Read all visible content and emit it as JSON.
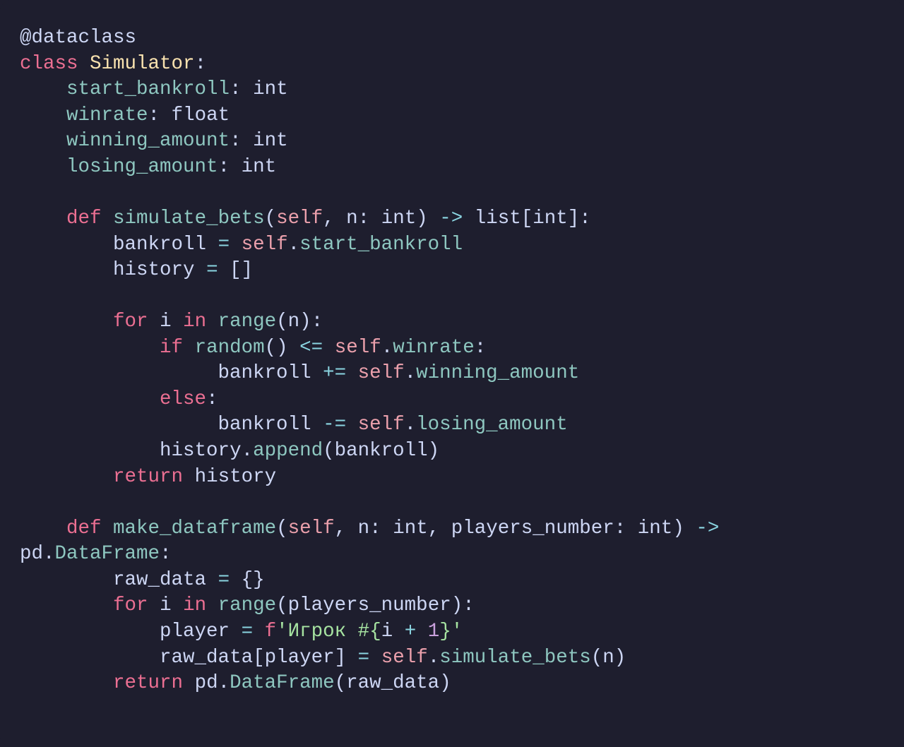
{
  "code": {
    "decorator_at": "@",
    "decorator_name": "dataclass",
    "kw_class": "class",
    "class_name": "Simulator",
    "colon": ":",
    "fields": {
      "start_bankroll": "start_bankroll",
      "winrate": "winrate",
      "winning_amount": "winning_amount",
      "losing_amount": "losing_amount"
    },
    "types": {
      "int": "int",
      "float": "float",
      "list_int": "list[int]"
    },
    "kw_def": "def",
    "fn_simulate_bets": "simulate_bets",
    "fn_make_dataframe": "make_dataframe",
    "param_self": "self",
    "param_n": "n",
    "param_players_number": "players_number",
    "arrow": "->",
    "var_bankroll": "bankroll",
    "var_history": "history",
    "var_i": "i",
    "var_raw_data": "raw_data",
    "var_player": "player",
    "op_assign": "=",
    "op_pluseq": "+=",
    "op_minuseq": "-=",
    "op_le": "<=",
    "op_plus": "+",
    "kw_for": "for",
    "kw_in": "in",
    "kw_if": "if",
    "kw_else": "else",
    "kw_return": "return",
    "call_range": "range",
    "call_random": "random",
    "call_append": "append",
    "call_DataFrame": "DataFrame",
    "call_simulate_bets": "simulate_bets",
    "attr_start_bankroll": "start_bankroll",
    "attr_winrate": "winrate",
    "attr_winning_amount": "winning_amount",
    "attr_losing_amount": "losing_amount",
    "ns_pd": "pd",
    "empty_list": "[]",
    "empty_dict": "{}",
    "lparen": "(",
    "rparen": ")",
    "lbrack": "[",
    "rbrack": "]",
    "lbrace": "{",
    "rbrace": "}",
    "comma_sp": ", ",
    "dot": ".",
    "num_1": "1",
    "f_prefix": "f",
    "str_q": "'",
    "str_igrok": "Игрок #",
    "str_brace_open": "{",
    "str_brace_close": "}"
  },
  "colors": {
    "background": "#1e1e2e",
    "foreground": "#cdd6f4",
    "keyword": "#eb6f92",
    "classname": "#f9e2af",
    "attr_fn": "#8ec7c0",
    "self": "#eba0ac",
    "number": "#c9a0dc",
    "string": "#a6e3a1",
    "operator": "#8bd5e1"
  }
}
